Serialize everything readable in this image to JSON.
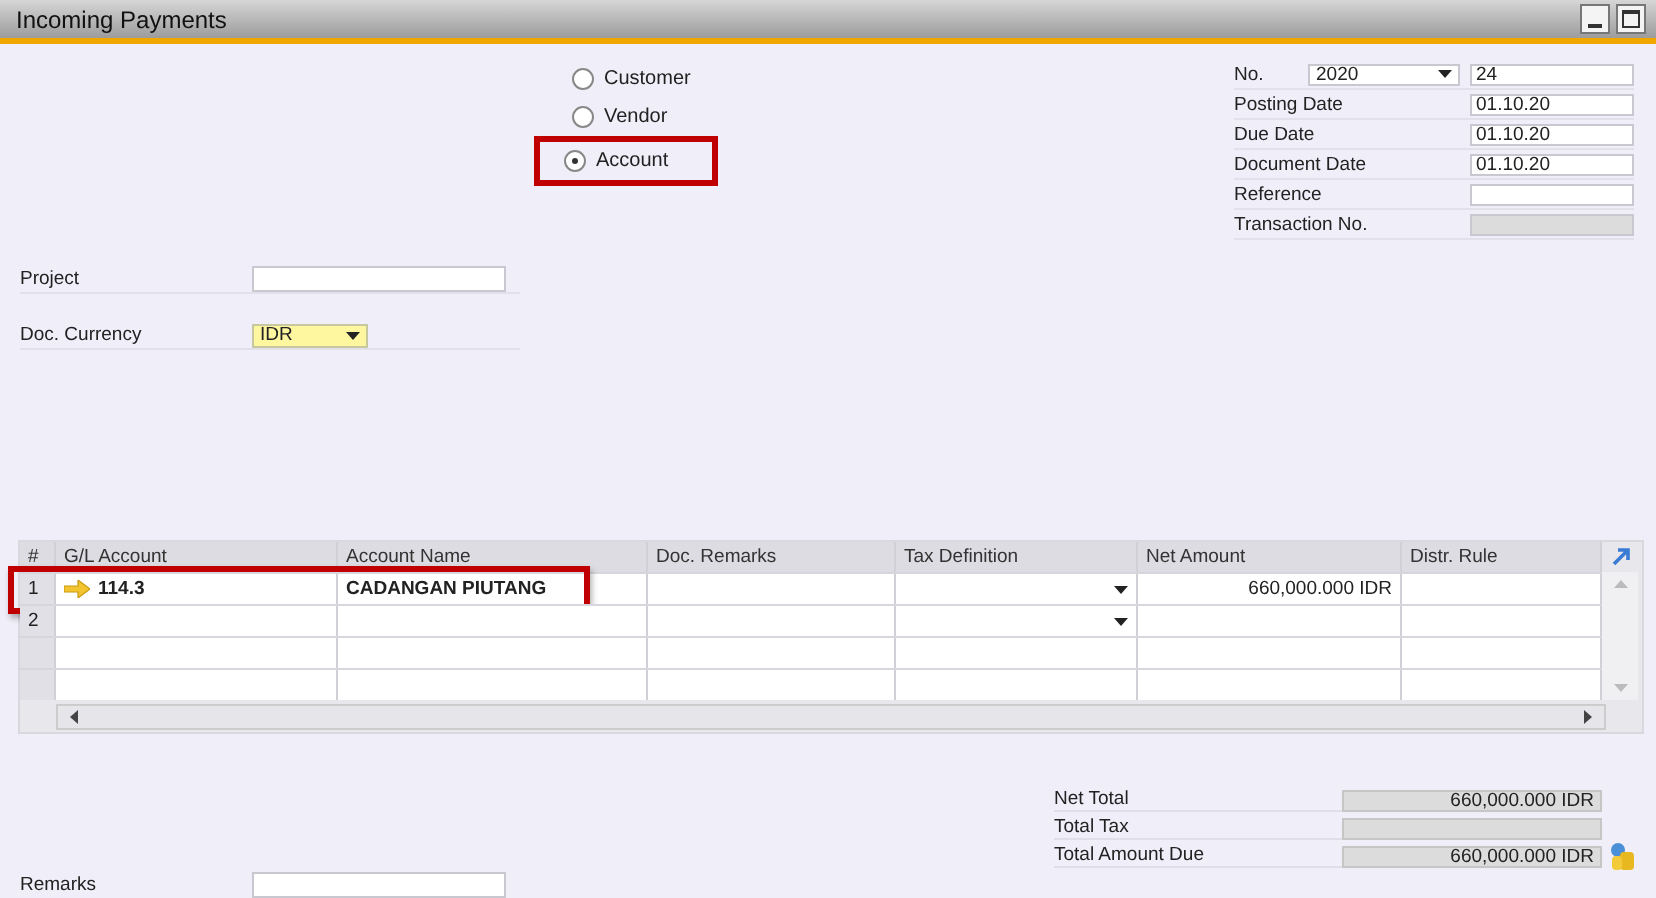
{
  "window": {
    "title": "Incoming Payments"
  },
  "payment_type": [
    {
      "label": "Customer",
      "selected": false,
      "highlighted": false
    },
    {
      "label": "Vendor",
      "selected": false,
      "highlighted": false
    },
    {
      "label": "Account",
      "selected": true,
      "highlighted": true
    }
  ],
  "header_fields": [
    {
      "kind": "series",
      "label": "No.",
      "series": "2020",
      "value": "24"
    },
    {
      "kind": "input",
      "label": "Posting Date",
      "value": "01.10.20"
    },
    {
      "kind": "input",
      "label": "Due Date",
      "value": "01.10.20"
    },
    {
      "kind": "input",
      "label": "Document Date",
      "value": "01.10.20"
    },
    {
      "kind": "input",
      "label": "Reference"
    },
    {
      "kind": "readonly",
      "label": "Transaction No."
    }
  ],
  "left_fields": [
    {
      "kind": "input",
      "label": "Project"
    },
    {
      "kind": "dropdown",
      "label": "Doc. Currency",
      "value": "IDR"
    }
  ],
  "table": {
    "columns": [
      "#",
      "G/L Account",
      "Account Name",
      "Doc. Remarks",
      "Tax Definition",
      "Net Amount",
      "Distr. Rule"
    ],
    "rows": [
      {
        "kind": "entry",
        "number": "1",
        "gl_account": "114.3",
        "account_name": "CADANGAN PIUTANG",
        "net_amount": "660,000.000 IDR",
        "highlighted": true
      },
      {
        "kind": "entry",
        "number": "2",
        "highlighted": false
      },
      {
        "kind": "blank",
        "highlighted": false
      },
      {
        "kind": "blank",
        "highlighted": false
      }
    ]
  },
  "totals": [
    {
      "kind": "plain",
      "label": "Net Total",
      "value": "660,000.000 IDR"
    },
    {
      "kind": "plain",
      "label": "Total Tax"
    },
    {
      "kind": "lookup",
      "label": "Total Amount Due",
      "value": "660,000.000 IDR"
    }
  ],
  "remarks": {
    "label": "Remarks"
  }
}
